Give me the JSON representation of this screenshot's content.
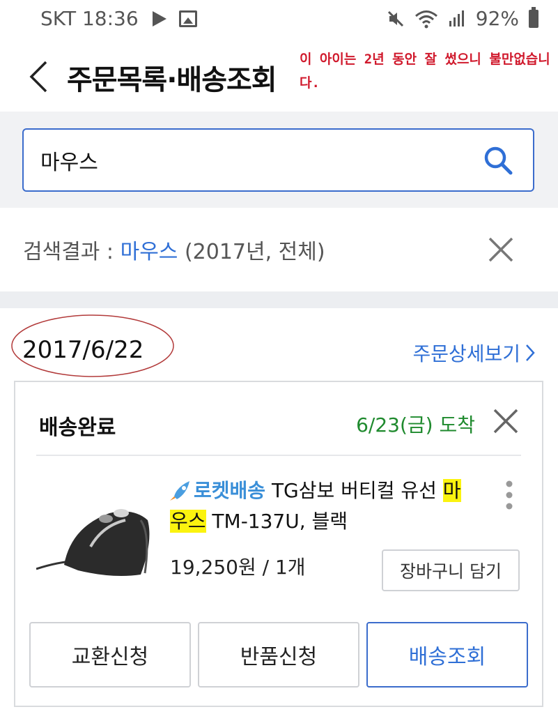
{
  "status_bar": {
    "carrier_time": "SKT 18:36",
    "battery": "92%",
    "icons": [
      "play-icon",
      "image-icon",
      "mute-icon",
      "wifi-icon",
      "signal-icon",
      "battery-icon"
    ]
  },
  "header": {
    "title": "주문목록·배송조회",
    "annotation": "이 아이는 2년 동안 잘 썼으니 불만없습니다."
  },
  "search": {
    "value": "마우스",
    "placeholder": ""
  },
  "result": {
    "prefix": "검색결과 : ",
    "keyword": "마우스",
    "suffix": " (2017년, 전체)"
  },
  "order": {
    "date": "2017/6/22",
    "detail_link": "주문상세보기",
    "status": "배송완료",
    "arrival": "6/23(금) 도착",
    "product": {
      "rocket_label": "로켓배송",
      "name_part1": " TG삼보 버티컬 유선 ",
      "highlight1": "마",
      "highlight2": "우스",
      "name_part2": " TM-137U, 블랙",
      "price": "19,250원 / 1개"
    },
    "cart_button": "장바구니 담기",
    "actions": {
      "exchange": "교환신청",
      "return": "반품신청",
      "track": "배송조회"
    }
  },
  "colors": {
    "accent_blue": "#2f6fd6",
    "search_border": "#3b6ccc",
    "arrival_green": "#1f8a2e",
    "highlight_yellow": "#fbf30f",
    "annotation_red": "#d0192c"
  }
}
